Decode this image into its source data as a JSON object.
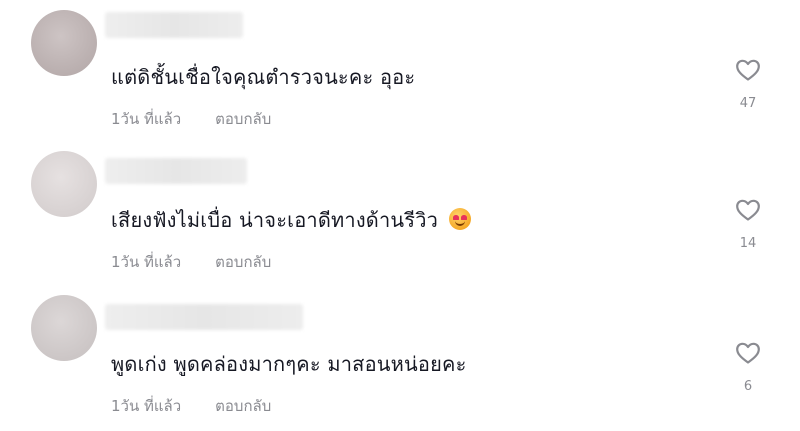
{
  "comments": [
    {
      "text": "แต่ดิชั้นเชื่อใจคุณตำรวจนะคะ อุอะ",
      "time": "1วัน ที่แล้ว",
      "reply_label": "ตอบกลับ",
      "likes": "47",
      "has_emoji": false
    },
    {
      "text": "เสียงฟังไม่เบื่อ น่าจะเอาดีทางด้านรีวิว",
      "time": "1วัน ที่แล้ว",
      "reply_label": "ตอบกลับ",
      "likes": "14",
      "has_emoji": true,
      "emoji_icon": "smiling-face-with-heart-eyes-icon"
    },
    {
      "text": "พูดเก่ง พูดคล่องมากๆคะ มาสอนหน่อยคะ",
      "time": "1วัน ที่แล้ว",
      "reply_label": "ตอบกลับ",
      "likes": "6",
      "has_emoji": false
    }
  ],
  "icons": {
    "like": "heart-outline-icon",
    "avatar": "avatar-placeholder"
  },
  "colors": {
    "text": "#161823",
    "meta": "#8a8b91",
    "icon": "#8a8b91"
  }
}
